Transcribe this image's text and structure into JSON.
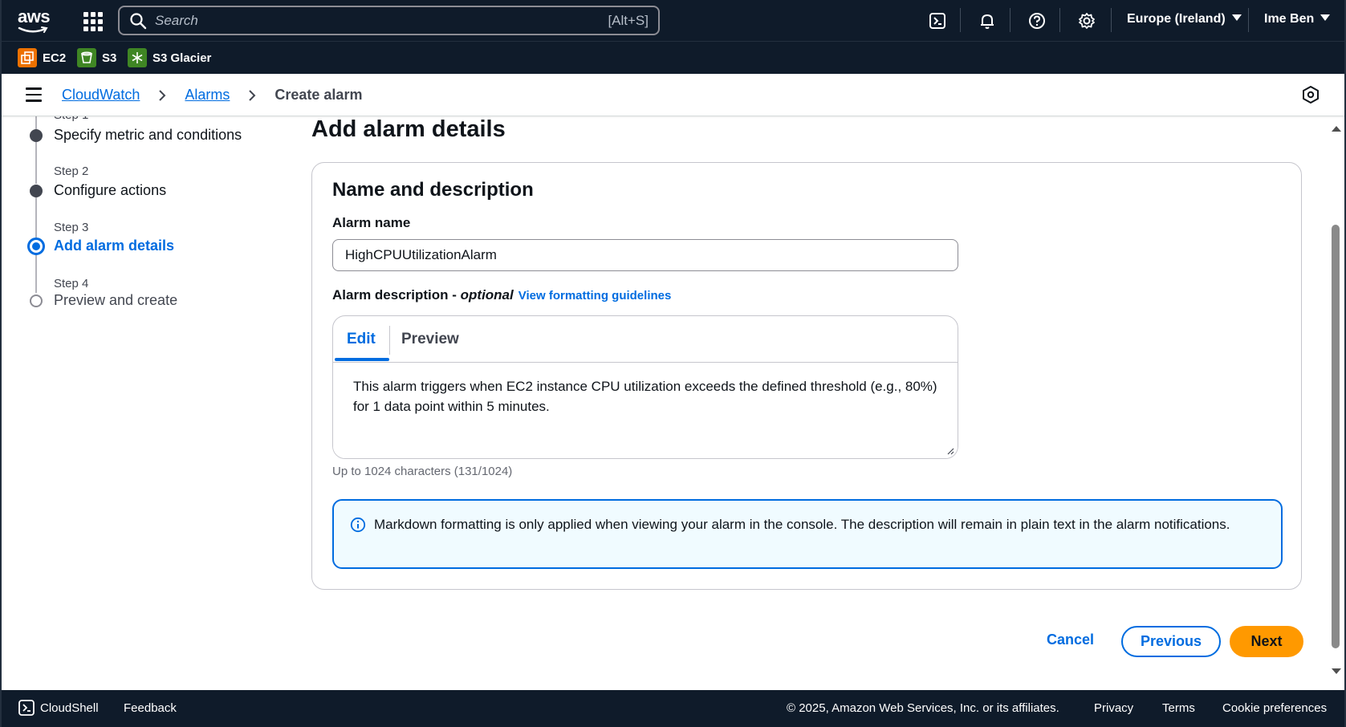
{
  "topnav": {
    "logo_text": "aws",
    "search_placeholder": "Search",
    "search_shortcut": "[Alt+S]",
    "region": "Europe (Ireland)",
    "user": "Ime Ben"
  },
  "services": [
    {
      "label": "EC2",
      "color": "#ed7100"
    },
    {
      "label": "S3",
      "color": "#3f8624"
    },
    {
      "label": "S3 Glacier",
      "color": "#3f8624"
    }
  ],
  "breadcrumb": {
    "items": [
      "CloudWatch",
      "Alarms"
    ],
    "current": "Create alarm"
  },
  "steps": [
    {
      "num": "Step 1",
      "title": "Specify metric and conditions",
      "state": "complete"
    },
    {
      "num": "Step 2",
      "title": "Configure actions",
      "state": "complete"
    },
    {
      "num": "Step 3",
      "title": "Add alarm details",
      "state": "current"
    },
    {
      "num": "Step 4",
      "title": "Preview and create",
      "state": "upcoming"
    }
  ],
  "main": {
    "title": "Add alarm details",
    "card_title": "Name and description",
    "alarm_name_label": "Alarm name",
    "alarm_name_value": "HighCPUUtilizationAlarm",
    "description_label": "Alarm description - ",
    "description_optional": "optional",
    "guidelines_link": "View formatting guidelines",
    "tabs": [
      "Edit",
      "Preview"
    ],
    "description_value": "This alarm triggers when EC2 instance CPU utilization exceeds the defined threshold (e.g., 80%) for 1 data point within 5 minutes.",
    "char_count": "Up to 1024 characters (131/1024)",
    "info_text": "Markdown formatting is only applied when viewing your alarm in the console. The description will remain in plain text in the alarm notifications."
  },
  "actions": {
    "cancel": "Cancel",
    "previous": "Previous",
    "next": "Next"
  },
  "footer": {
    "cloudshell": "CloudShell",
    "feedback": "Feedback",
    "copyright": "© 2025, Amazon Web Services, Inc. or its affiliates.",
    "privacy": "Privacy",
    "terms": "Terms",
    "cookies": "Cookie preferences"
  },
  "colors": {
    "accent": "#006ce0",
    "primary_button": "#ff9900",
    "nav_bg": "#0f1b2a"
  }
}
